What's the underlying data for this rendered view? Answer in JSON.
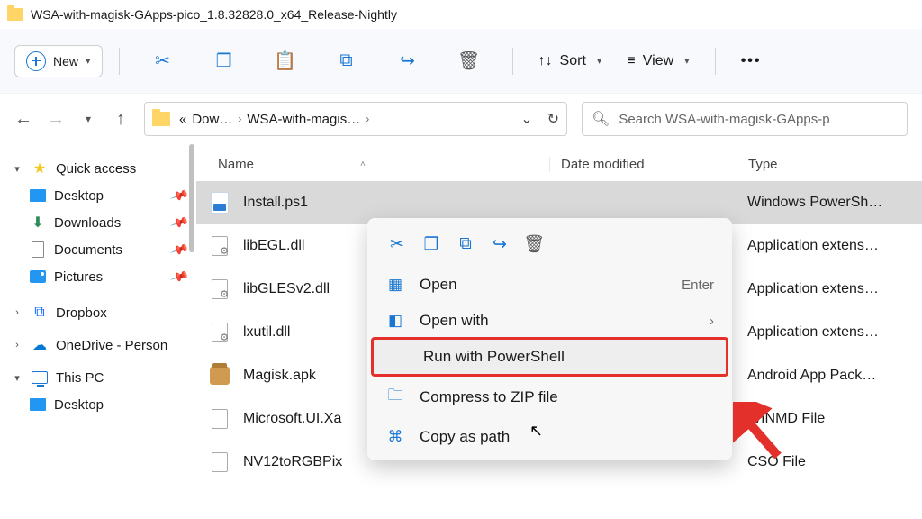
{
  "title": "WSA-with-magisk-GApps-pico_1.8.32828.0_x64_Release-Nightly",
  "toolbar": {
    "new": "New",
    "sort": "Sort",
    "view": "View"
  },
  "breadcrumb": {
    "seg1": "Dow…",
    "seg2": "WSA-with-magis…"
  },
  "search": {
    "placeholder": "Search WSA-with-magisk-GApps-p"
  },
  "sidebar": {
    "quick": "Quick access",
    "desktop": "Desktop",
    "downloads": "Downloads",
    "documents": "Documents",
    "pictures": "Pictures",
    "dropbox": "Dropbox",
    "onedrive": "OneDrive - Person",
    "thispc": "This PC",
    "desktop2": "Desktop"
  },
  "cols": {
    "name": "Name",
    "date": "Date modified",
    "type": "Type"
  },
  "rows": [
    {
      "name": "Install.ps1",
      "date": "",
      "type": "Windows PowerSh…"
    },
    {
      "name": "libEGL.dll",
      "date": "",
      "type": "Application extens…"
    },
    {
      "name": "libGLESv2.dll",
      "date": "",
      "type": "Application extens…"
    },
    {
      "name": "lxutil.dll",
      "date": "",
      "type": "Application extens…"
    },
    {
      "name": "Magisk.apk",
      "date": "",
      "type": "Android App Pack…"
    },
    {
      "name": "Microsoft.UI.Xa",
      "date": "",
      "type": "WINMD File"
    },
    {
      "name": "NV12toRGBPix",
      "date": "",
      "type": "CSO File"
    }
  ],
  "ctx": {
    "open": "Open",
    "open_hint": "Enter",
    "openwith": "Open with",
    "runps": "Run with PowerShell",
    "zip": "Compress to ZIP file",
    "copypath": "Copy as path"
  }
}
